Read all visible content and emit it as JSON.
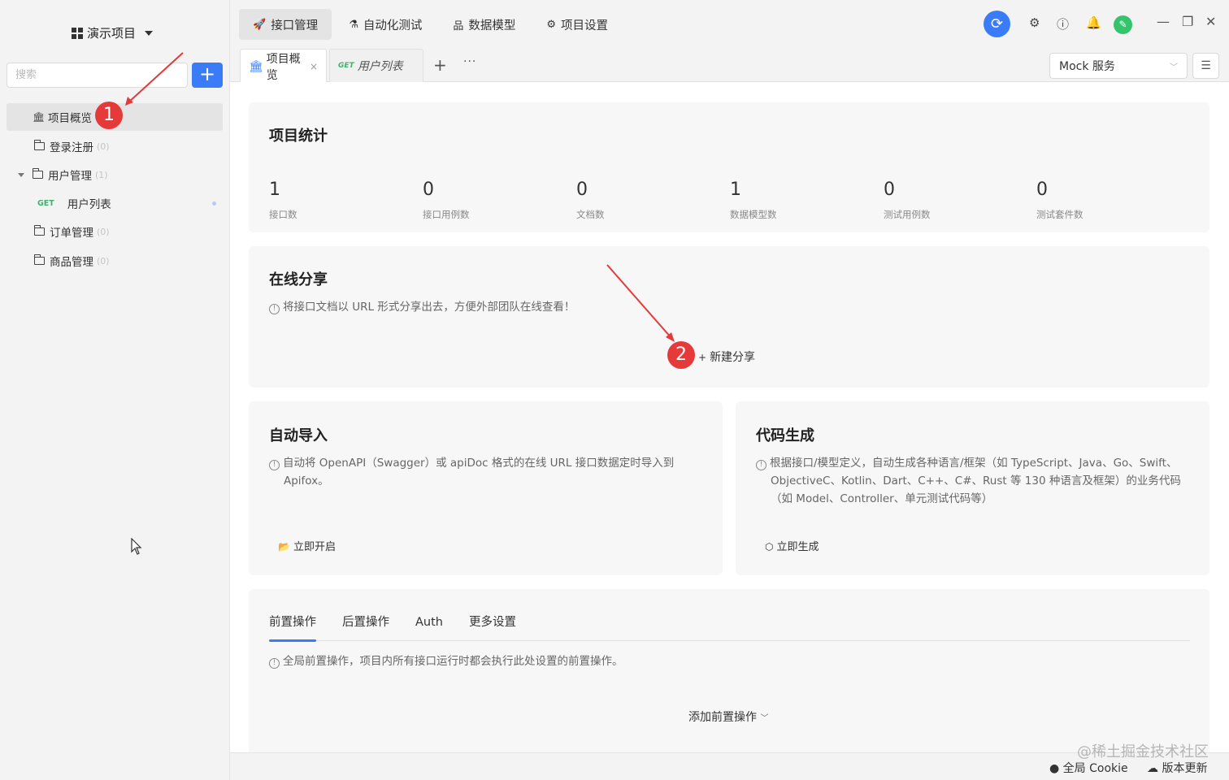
{
  "sidebar": {
    "project_name": "演示项目",
    "search_placeholder": "搜索",
    "add_label": "+",
    "items": [
      {
        "label": "项目概览",
        "count": ""
      },
      {
        "label": "登录注册",
        "count": "(0)"
      },
      {
        "label": "用户管理",
        "count": "(1)"
      },
      {
        "label": "用户列表",
        "method": "GET"
      },
      {
        "label": "订单管理",
        "count": "(0)"
      },
      {
        "label": "商品管理",
        "count": "(0)"
      }
    ]
  },
  "topnav": [
    {
      "label": "接口管理",
      "icon": "rocket-icon"
    },
    {
      "label": "自动化测试",
      "icon": "flask-icon"
    },
    {
      "label": "数据模型",
      "icon": "sitemap-icon"
    },
    {
      "label": "项目设置",
      "icon": "gear-icon"
    }
  ],
  "tabs": [
    {
      "label": "项目概览",
      "close": "×"
    },
    {
      "label": "用户列表",
      "method": "GET"
    }
  ],
  "mock_service": "Mock 服务",
  "stats": {
    "title": "项目统计",
    "items": [
      {
        "num": "1",
        "label": "接口数"
      },
      {
        "num": "0",
        "label": "接口用例数"
      },
      {
        "num": "0",
        "label": "文档数"
      },
      {
        "num": "1",
        "label": "数据模型数"
      },
      {
        "num": "0",
        "label": "测试用例数"
      },
      {
        "num": "0",
        "label": "测试套件数"
      }
    ]
  },
  "share": {
    "title": "在线分享",
    "desc": "将接口文档以 URL 形式分享出去，方便外部团队在线查看！",
    "action": "新建分享"
  },
  "auto_import": {
    "title": "自动导入",
    "desc_line1": "自动将 OpenAPI（Swagger）或 apiDoc 格式的在线 URL 接口数据定时导入到",
    "desc_line2": "Apifox。",
    "action": "立即开启"
  },
  "codegen": {
    "title": "代码生成",
    "desc_line1": "根据接口/模型定义，自动生成各种语言/框架（如 TypeScript、Java、Go、Swift、",
    "desc_line2": "ObjectiveC、Kotlin、Dart、C++、C#、Rust 等 130 种语言及框架）的业务代码",
    "desc_line3": "（如 Model、Controller、单元测试代码等）",
    "action": "立即生成"
  },
  "settings": {
    "tabs": [
      "前置操作",
      "后置操作",
      "Auth",
      "更多设置"
    ],
    "desc": "全局前置操作，项目内所有接口运行时都会执行此处设置的前置操作。",
    "add_action": "添加前置操作"
  },
  "bottom": {
    "cookie": "全局 Cookie",
    "update": "版本更新",
    "watermark": "@稀土掘金技术社区"
  },
  "annotations": [
    "1",
    "2"
  ],
  "colors": {
    "accent": "#3a7cf7",
    "get": "#3eb370",
    "annotation": "#e53a3a"
  }
}
